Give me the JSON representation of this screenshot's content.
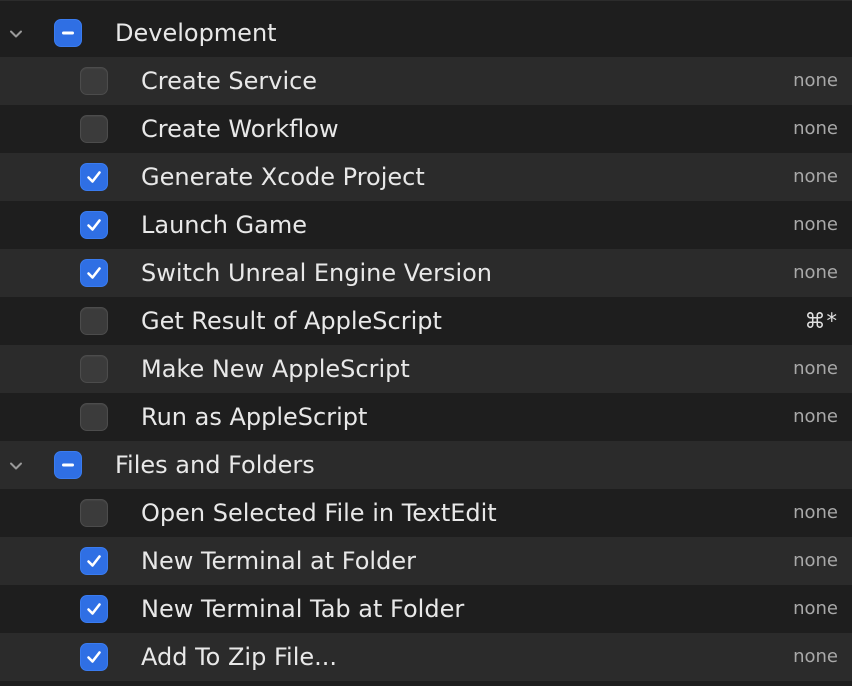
{
  "groups": [
    {
      "label": "Development",
      "state": "mixed",
      "expanded": true,
      "items": [
        {
          "label": "Create Service",
          "checked": false,
          "shortcut": "none"
        },
        {
          "label": "Create Workflow",
          "checked": false,
          "shortcut": "none"
        },
        {
          "label": "Generate Xcode Project",
          "checked": true,
          "shortcut": "none"
        },
        {
          "label": "Launch Game",
          "checked": true,
          "shortcut": "none"
        },
        {
          "label": "Switch Unreal Engine Version",
          "checked": true,
          "shortcut": "none"
        },
        {
          "label": "Get Result of AppleScript",
          "checked": false,
          "shortcut": "⌘*"
        },
        {
          "label": "Make New AppleScript",
          "checked": false,
          "shortcut": "none"
        },
        {
          "label": "Run as AppleScript",
          "checked": false,
          "shortcut": "none"
        }
      ]
    },
    {
      "label": "Files and Folders",
      "state": "mixed",
      "expanded": true,
      "items": [
        {
          "label": "Open Selected File in TextEdit",
          "checked": false,
          "shortcut": "none"
        },
        {
          "label": "New Terminal at Folder",
          "checked": true,
          "shortcut": "none"
        },
        {
          "label": "New Terminal Tab at Folder",
          "checked": true,
          "shortcut": "none"
        },
        {
          "label": "Add To Zip File...",
          "checked": true,
          "shortcut": "none"
        }
      ]
    }
  ],
  "colors": {
    "accent": "#2f6fe4",
    "row_alt": "#2b2b2b",
    "background": "#1e1e1e"
  }
}
